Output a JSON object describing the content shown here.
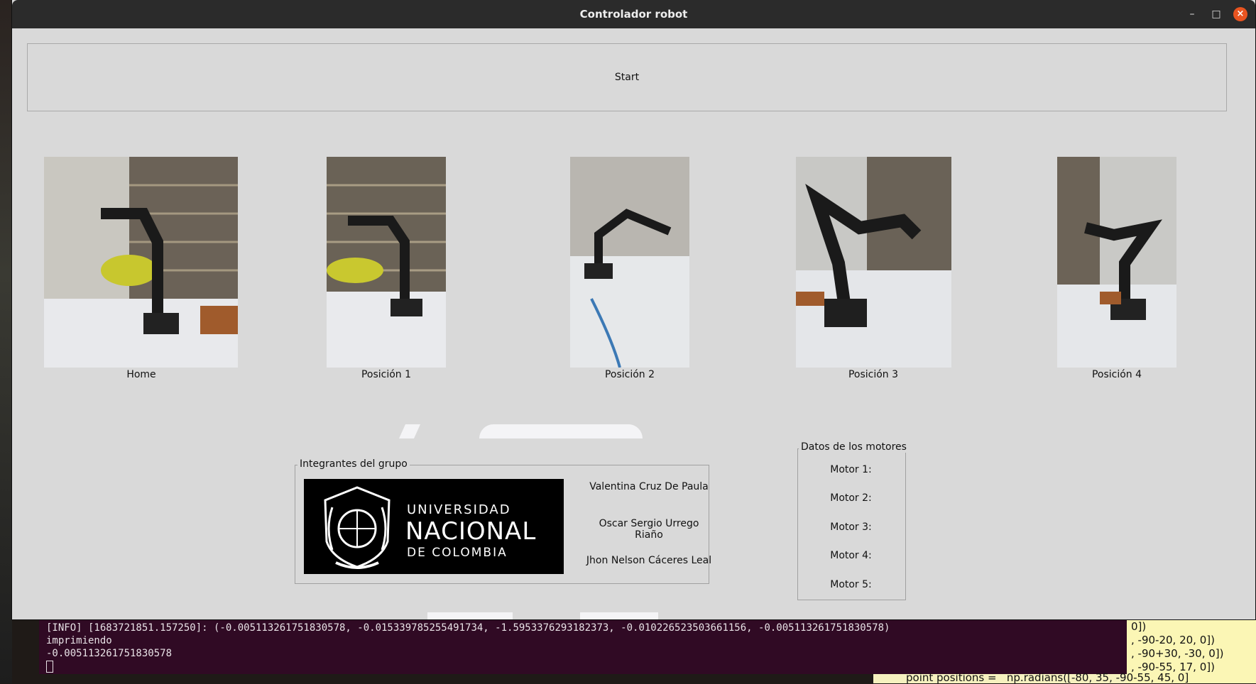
{
  "window": {
    "title": "Controlador robot",
    "minimize_glyph": "–",
    "maximize_glyph": "□",
    "close_glyph": "×"
  },
  "start_button": {
    "label": "Start"
  },
  "positions": [
    {
      "label": "Home",
      "image": "robot-arm-photo"
    },
    {
      "label": "Posición 1",
      "image": "robot-arm-photo"
    },
    {
      "label": "Posición 2",
      "image": "robot-arm-photo"
    },
    {
      "label": "Posición 3",
      "image": "robot-arm-photo"
    },
    {
      "label": "Posición 4",
      "image": "robot-arm-photo"
    }
  ],
  "group": {
    "title": "Integrantes del grupo",
    "logo": {
      "line1": "UNIVERSIDAD",
      "line2": "NACIONAL",
      "line3": "DE COLOMBIA"
    },
    "members": [
      "Valentina Cruz De Paula",
      "Oscar Sergio Urrego Riaño",
      "Jhon Nelson Cáceres Leal"
    ]
  },
  "motors": {
    "title": "Datos de los motores",
    "items": [
      "Motor 1:",
      "Motor 2:",
      "Motor 3:",
      "Motor 4:",
      "Motor 5:"
    ]
  },
  "terminal": {
    "lines": [
      "[INFO] [1683721851.157250]: (-0.005113261751830578, -0.015339785255491734, -1.5953376293182373, -0.010226523503661156, -0.005113261751830578)",
      "imprimiendo",
      "-0.005113261751830578"
    ]
  },
  "editor": {
    "lines": [
      "0])",
      ", -90-20, 20, 0])",
      ", -90+30, -30, 0])",
      ", -90-55, 17, 0])"
    ],
    "bottom_line": "point positions =   np.radians([-80, 35, -90-55, 45, 0]"
  }
}
